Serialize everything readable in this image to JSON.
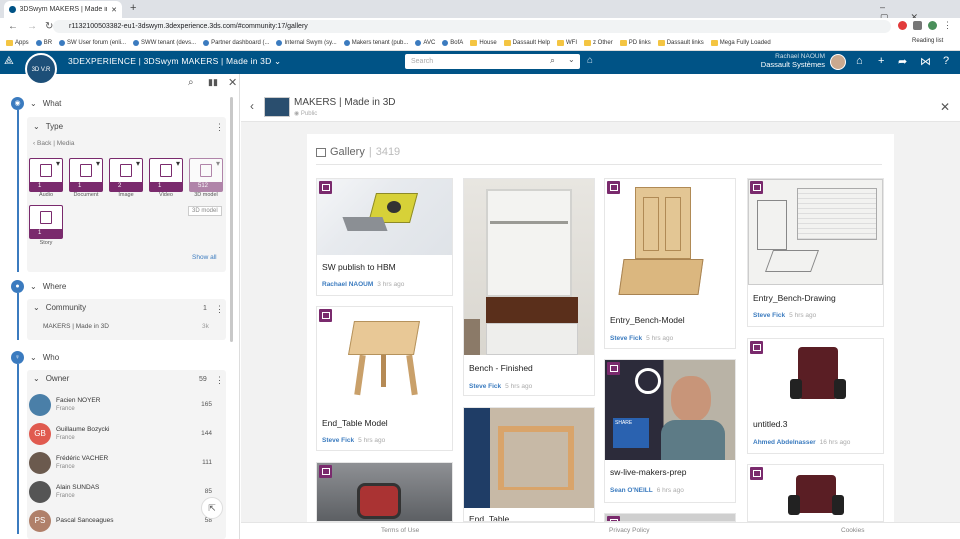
{
  "browser": {
    "tab_title": "3DSwym MAKERS | Made in 3D",
    "url": "r1132100503382-eu1-3dswym.3dexperience.3ds.com/#community:17/gallery",
    "bookmarks": [
      "Apps",
      "BR",
      "SW User forum (enli...",
      "SWW tenant (devs...",
      "Partner dashboard (...",
      "Internal Swym (sy...",
      "Makers tenant (pub...",
      "AVC",
      "BofA",
      "House",
      "Dassault Help",
      "WFI",
      "z Other",
      "PD links",
      "Dassault links",
      "Mega Fully Loaded"
    ],
    "reading_list": "Reading list"
  },
  "topbar": {
    "logo_text": "3D V.R",
    "app_title": "3DEXPERIENCE | 3DSwym  MAKERS | Made in 3D",
    "search_placeholder": "Search",
    "user_name": "Rachael NAOUM",
    "user_company": "Dassault Systèmes"
  },
  "filters": {
    "what": {
      "label": "What",
      "type_label": "Type",
      "back": "Back",
      "crumb": "Media",
      "media": [
        {
          "name": "Audio",
          "count": "1",
          "icon": "audio-icon"
        },
        {
          "name": "Document",
          "count": "1",
          "icon": "document-icon"
        },
        {
          "name": "Image",
          "count": "2",
          "icon": "image-icon"
        },
        {
          "name": "Video",
          "count": "1",
          "icon": "video-icon"
        },
        {
          "name": "3D model",
          "count": "512",
          "icon": "cube-icon"
        }
      ],
      "tooltip": "3D model",
      "story": {
        "name": "Story",
        "count": "1"
      },
      "show_all": "Show all"
    },
    "where": {
      "label": "Where",
      "community_label": "Community",
      "community_count": "1",
      "community_name": "MAKERS | Made in 3D",
      "community_value": "3k"
    },
    "who": {
      "label": "Who",
      "owner_label": "Owner",
      "owner_count": "59",
      "owners": [
        {
          "name": "Facien NOYER",
          "country": "France",
          "count": "165",
          "color": "#4a7fa8",
          "initials": ""
        },
        {
          "name": "Guillaume Bozycki",
          "country": "France",
          "count": "144",
          "color": "#e05a4f",
          "initials": "GB"
        },
        {
          "name": "Frédéric VACHER",
          "country": "France",
          "count": "111",
          "color": "#6b5a4e",
          "initials": ""
        },
        {
          "name": "Alain SUNDAS",
          "country": "France",
          "count": "85",
          "color": "#555555",
          "initials": ""
        },
        {
          "name": "Pascal Sanceagues",
          "country": "",
          "count": "58",
          "color": "#b0806a",
          "initials": "PS"
        }
      ]
    }
  },
  "community": {
    "title": "MAKERS | Made in 3D",
    "visibility": "Public"
  },
  "gallery": {
    "title": "Gallery",
    "count": "3419",
    "posts": [
      {
        "title": "SW publish to HBM",
        "author": "Rachael NAOUM",
        "time": "3 hrs ago"
      },
      {
        "title": "End_Table Model",
        "author": "Steve Fick",
        "time": "5 hrs ago"
      },
      {
        "title": "",
        "author": "",
        "time": ""
      },
      {
        "title": "Bench - Finished",
        "author": "Steve Fick",
        "time": "5 hrs ago"
      },
      {
        "title": "End_Table",
        "author": "",
        "time": ""
      },
      {
        "title": "Entry_Bench-Model",
        "author": "Steve Fick",
        "time": "5 hrs ago"
      },
      {
        "title": "sw-live-makers-prep",
        "author": "Sean O'NEILL",
        "time": "6 hrs ago"
      },
      {
        "title": "",
        "author": "",
        "time": ""
      },
      {
        "title": "Entry_Bench-Drawing",
        "author": "Steve Fick",
        "time": "5 hrs ago"
      },
      {
        "title": "untitled.3",
        "author": "Ahmed Abdelnasser",
        "time": "16 hrs ago"
      },
      {
        "title": "",
        "author": "",
        "time": ""
      }
    ]
  },
  "footer": {
    "terms": "Terms of Use",
    "privacy": "Privacy Policy",
    "cookies": "Cookies"
  },
  "colors": {
    "brand_blue": "#005386",
    "media_purple": "#7a2a6d",
    "link_blue": "#3b7bbf"
  }
}
